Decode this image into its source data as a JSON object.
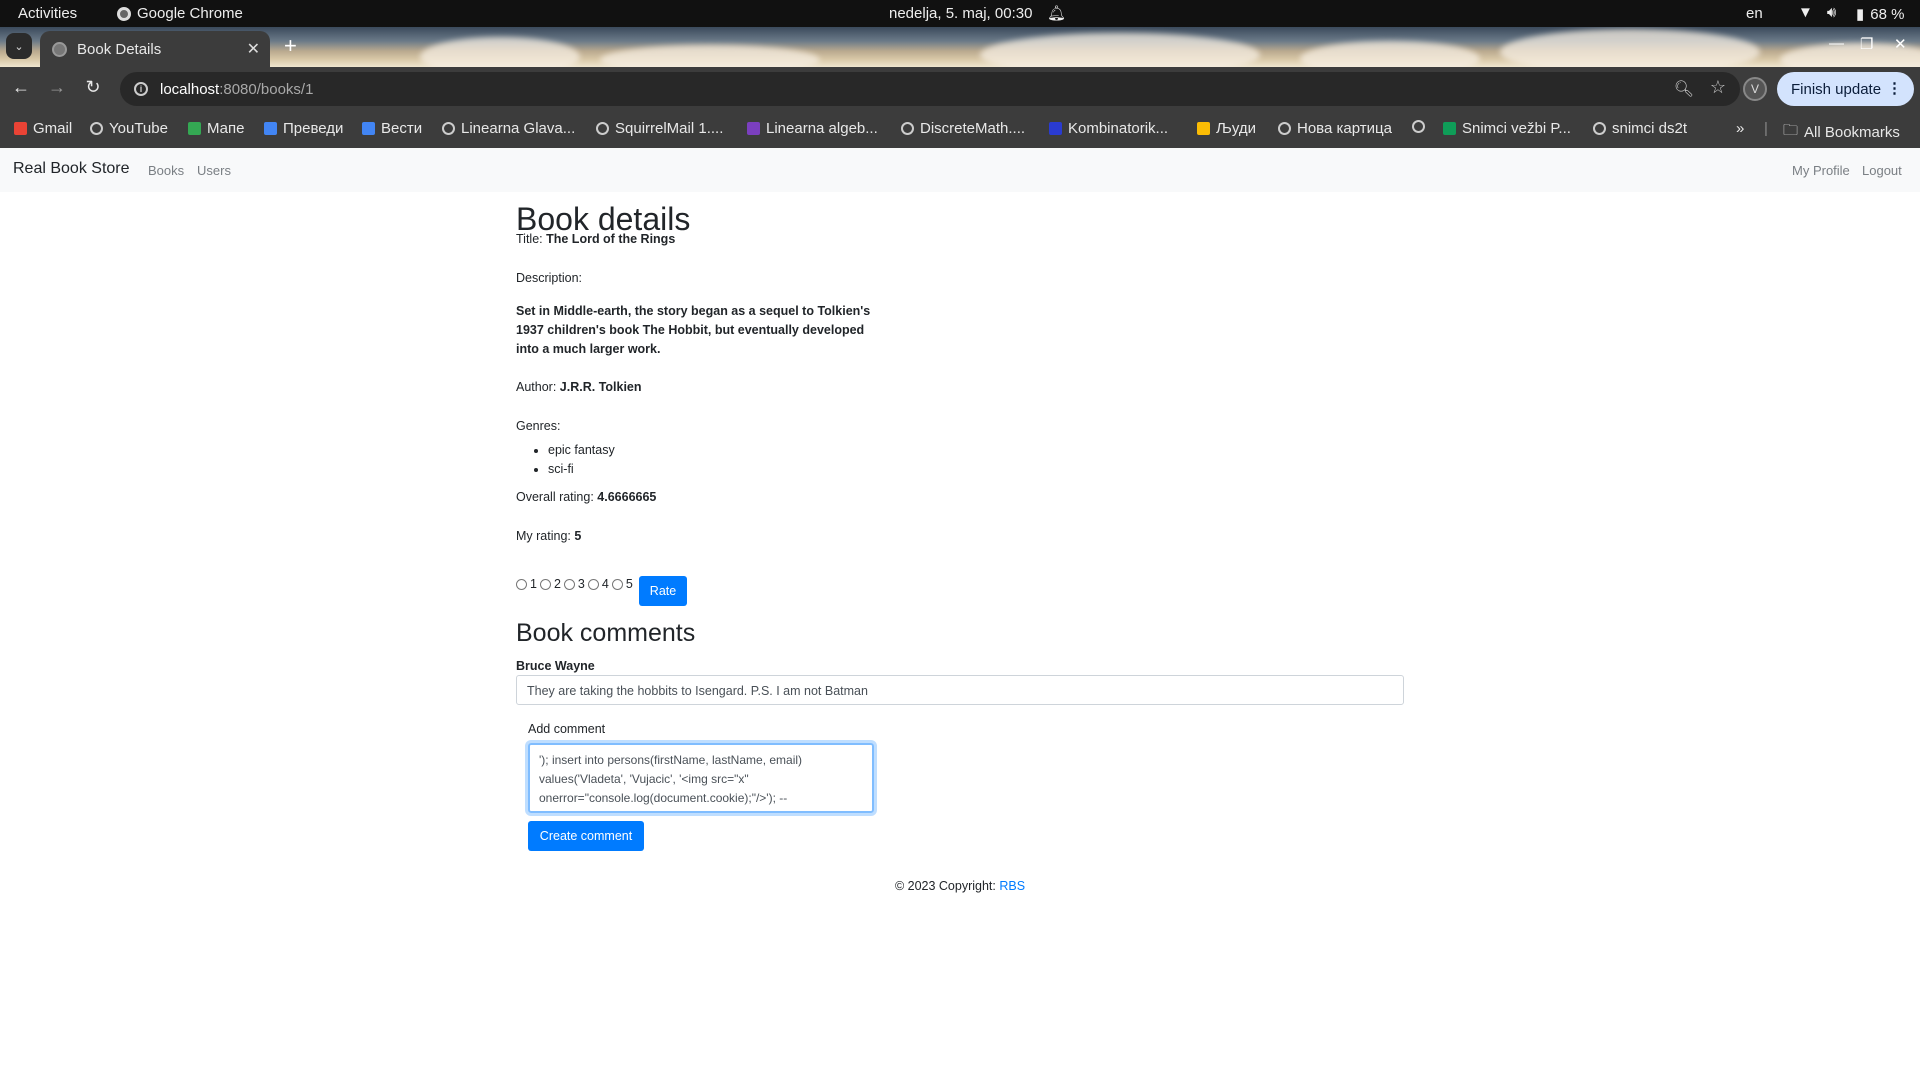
{
  "system_bar": {
    "activities": "Activities",
    "app_name": "Google Chrome",
    "clock": "nedelja,  5. maj, 00:30",
    "language": "en",
    "battery": "68 %"
  },
  "browser": {
    "tab_title": "Book Details",
    "url_host": "localhost",
    "url_path": ":8080/books/1",
    "profile_initial": "V",
    "finish_update": "Finish update",
    "bookmarks": [
      {
        "label": "Gmail",
        "icon": "gmail-icon",
        "color": "#ea4335"
      },
      {
        "label": "YouTube",
        "icon": "globe-icon",
        "color": ""
      },
      {
        "label": "Мапе",
        "icon": "maps-icon",
        "color": "#34a853"
      },
      {
        "label": "Преведи",
        "icon": "translate-icon",
        "color": "#4285f4"
      },
      {
        "label": "Вести",
        "icon": "news-icon",
        "color": "#4285f4"
      },
      {
        "label": "Linearna Glava...",
        "icon": "globe-icon",
        "color": ""
      },
      {
        "label": "SquirrelMail 1....",
        "icon": "globe-icon",
        "color": ""
      },
      {
        "label": "Linearna algeb...",
        "icon": "puzzle-icon",
        "color": "#7b3fbf"
      },
      {
        "label": "DiscreteMath....",
        "icon": "globe-icon",
        "color": ""
      },
      {
        "label": "Kombinatorik...",
        "icon": "m-icon",
        "color": "#2a3bd1"
      },
      {
        "label": "Људи",
        "icon": "contacts-icon",
        "color": "#fbbc04"
      },
      {
        "label": "Нова картица",
        "icon": "globe-icon",
        "color": ""
      },
      {
        "label": "",
        "icon": "globe-icon",
        "color": ""
      },
      {
        "label": "Snimci vežbi P...",
        "icon": "sheets-icon",
        "color": "#0f9d58"
      },
      {
        "label": "snimci ds2t",
        "icon": "globe-icon",
        "color": ""
      }
    ],
    "all_bookmarks": "All Bookmarks"
  },
  "navbar": {
    "brand": "Real Book Store",
    "links": [
      "Books",
      "Users"
    ],
    "right_links": [
      "My Profile",
      "Logout"
    ]
  },
  "book": {
    "heading": "Book details",
    "title_label": "Title:",
    "title": "The Lord of the Rings",
    "description_label": "Description:",
    "description": "Set in Middle-earth, the story began as a sequel to Tolkien's 1937 children's book The Hobbit, but eventually developed into a much larger work.",
    "author_label": "Author:",
    "author": "J.R.R. Tolkien",
    "genres_label": "Genres:",
    "genres": [
      "epic fantasy",
      "sci-fi"
    ],
    "overall_rating_label": "Overall rating:",
    "overall_rating": "4.6666665",
    "my_rating_label": "My rating:",
    "my_rating": "5",
    "rating_options": [
      "1",
      "2",
      "3",
      "4",
      "5"
    ],
    "rate_button": "Rate"
  },
  "comments": {
    "heading": "Book comments",
    "items": [
      {
        "author": "Bruce Wayne",
        "text": "They are taking the hobbits to Isengard. P.S. I am not Batman"
      }
    ],
    "add_label": "Add comment",
    "draft": "'); insert into persons(firstName, lastName, email)\nvalues('Vladeta', 'Vujacic', '<img src=\"x\"\nonerror=\"console.log(document.cookie);\"/>'); --",
    "create_button": "Create comment"
  },
  "footer": {
    "copyright": "© 2023 Copyright:",
    "link": "RBS"
  },
  "colors": {
    "primary": "#007bff",
    "navbar_bg": "#f8f9fa",
    "chrome_dark": "#3c3c3c"
  }
}
